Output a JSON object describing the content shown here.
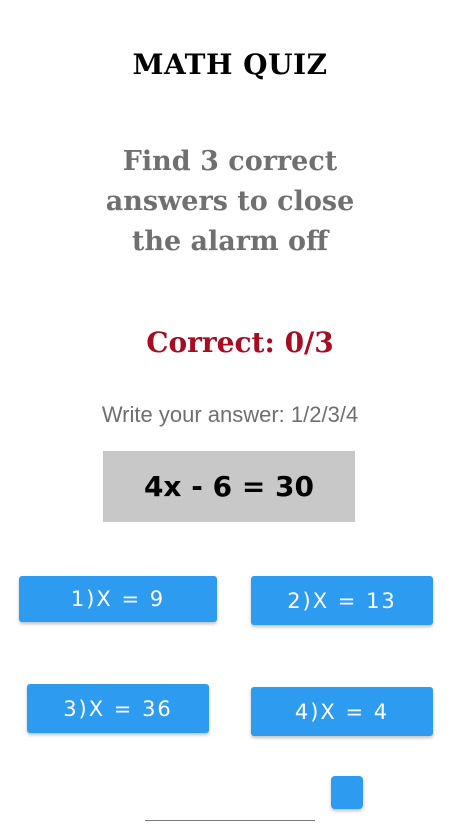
{
  "header": {
    "title": "MATH QUIZ"
  },
  "instructions": {
    "text": "Find 3 correct answers to close the alarm off"
  },
  "score": {
    "text": "Correct: 0/3"
  },
  "hint": {
    "text": "Write your answer: 1/2/3/4"
  },
  "question": {
    "equation": "4x - 6 = 30"
  },
  "answers": [
    {
      "label": "1)X = 9"
    },
    {
      "label": "2)X = 13"
    },
    {
      "label": "3)X = 36"
    },
    {
      "label": "4)X = 4"
    }
  ],
  "input": {
    "value": ""
  },
  "colors": {
    "button": "#2d9bf0",
    "score": "#a80b22",
    "equation_bg": "#c8c8c8",
    "instructions": "#707070"
  }
}
